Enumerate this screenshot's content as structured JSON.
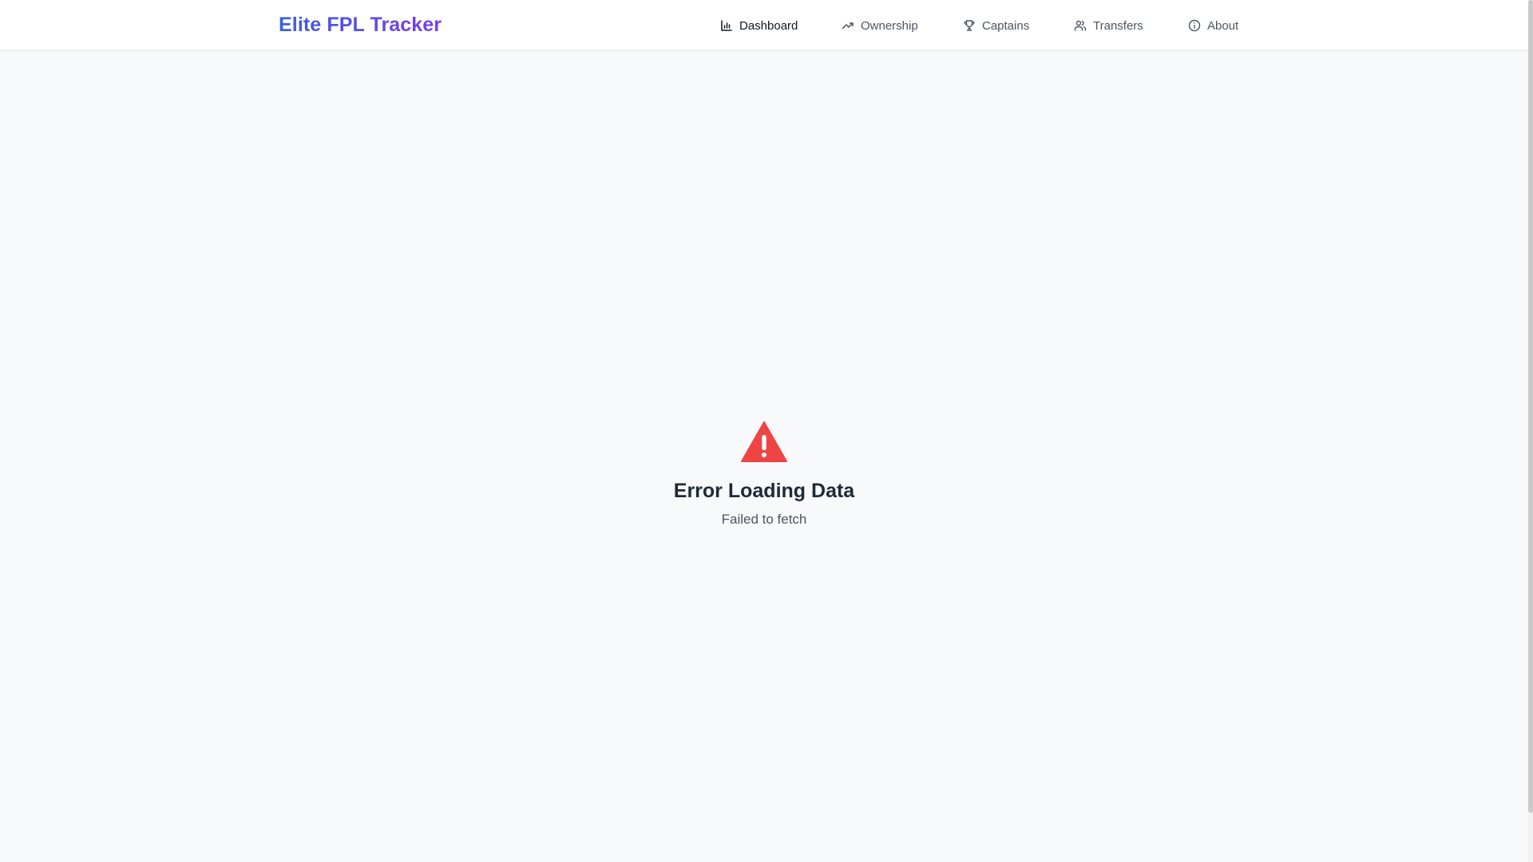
{
  "header": {
    "brand": "Elite FPL Tracker",
    "brand_gradient": [
      "#3b5fe0",
      "#7c3aed"
    ],
    "nav": [
      {
        "label": "Dashboard",
        "icon": "bar-chart-icon",
        "active": true
      },
      {
        "label": "Ownership",
        "icon": "trending-up-icon",
        "active": false
      },
      {
        "label": "Captains",
        "icon": "trophy-icon",
        "active": false
      },
      {
        "label": "Transfers",
        "icon": "users-icon",
        "active": false
      },
      {
        "label": "About",
        "icon": "info-icon",
        "active": false
      }
    ]
  },
  "error": {
    "icon": "warning-triangle-icon",
    "icon_color": "#ef4444",
    "title": "Error Loading Data",
    "message": "Failed to fetch"
  }
}
